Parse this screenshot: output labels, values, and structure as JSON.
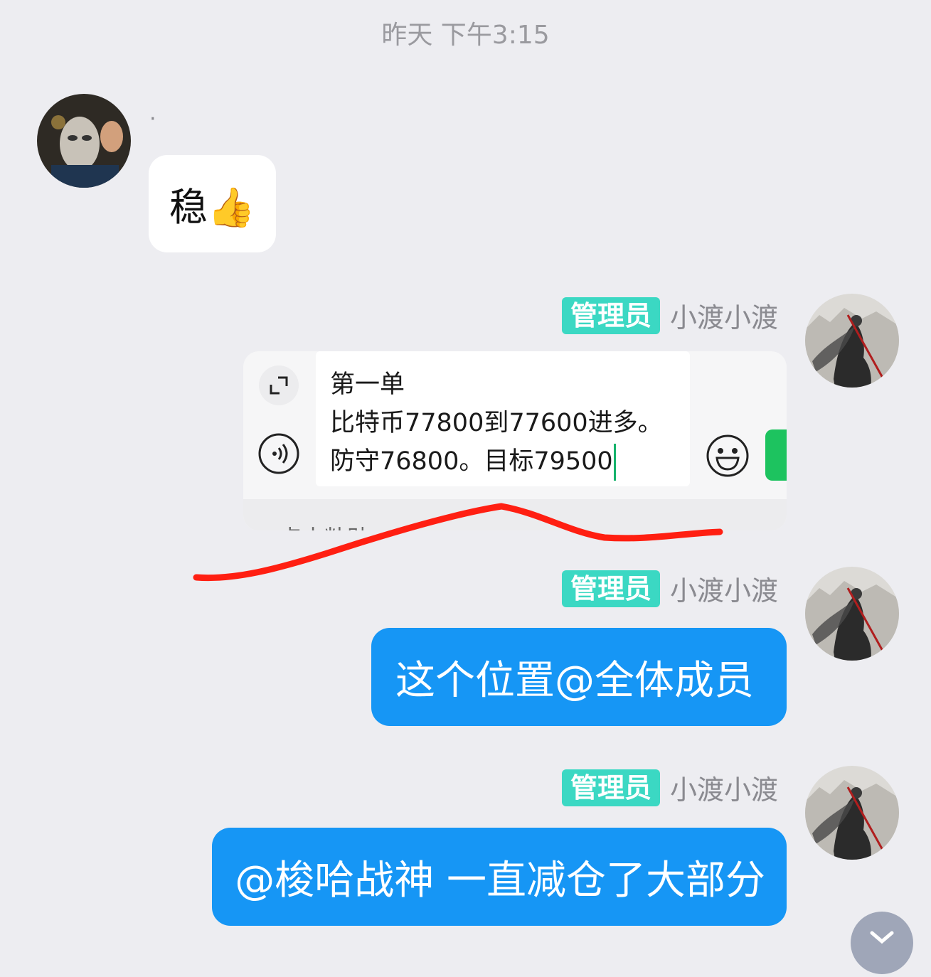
{
  "timestamp": "昨天 下午3:15",
  "messages": [
    {
      "sender": "·",
      "text": "稳👍"
    },
    {
      "badge": "管理员",
      "sender": "小渡小渡",
      "card": {
        "lines": [
          "第一单",
          "比特币77800到77600进多。",
          "防守76800。目标79500"
        ],
        "bottom_text": "点击粘贴"
      }
    },
    {
      "badge": "管理员",
      "sender": "小渡小渡",
      "text": "这个位置@全体成员"
    },
    {
      "badge": "管理员",
      "sender": "小渡小渡",
      "text": "@梭哈战神 一直减仓了大部分"
    }
  ],
  "colors": {
    "background": "#ededf1",
    "bubble_blue": "#1696f5",
    "admin_badge": "#3bd8c3",
    "annotation": "#ff1f12",
    "send_green": "#1dc35f"
  },
  "icons": {
    "expand": "expand-icon",
    "voice": "voice-icon",
    "emoji": "emoji-icon",
    "scroll": "chevron-down-icon"
  }
}
